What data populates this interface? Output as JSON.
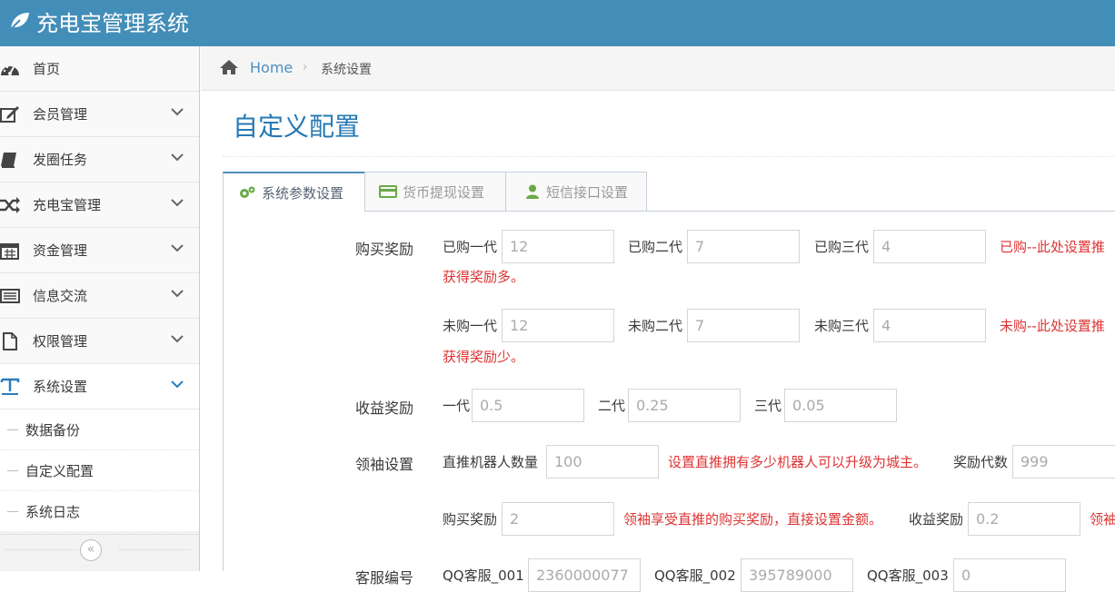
{
  "app": {
    "title": "充电宝管理系统"
  },
  "sidebar": {
    "items": [
      {
        "label": "首页",
        "icon": "dashboard-icon"
      },
      {
        "label": "会员管理",
        "icon": "edit-icon"
      },
      {
        "label": "发圈任务",
        "icon": "book-icon"
      },
      {
        "label": "充电宝管理",
        "icon": "random-icon"
      },
      {
        "label": "资金管理",
        "icon": "calendar-icon"
      },
      {
        "label": "信息交流",
        "icon": "list-icon"
      },
      {
        "label": "权限管理",
        "icon": "file-icon"
      },
      {
        "label": "系统设置",
        "icon": "text-width-icon"
      }
    ],
    "sub_items": [
      {
        "label": "数据备份"
      },
      {
        "label": "自定义配置"
      },
      {
        "label": "系统日志"
      }
    ],
    "collapse": "«"
  },
  "breadcrumb": {
    "home": "Home",
    "current": "系统设置"
  },
  "page": {
    "title": "自定义配置"
  },
  "tabs": [
    {
      "label": "系统参数设置",
      "icon": "cogs-icon",
      "active": true
    },
    {
      "label": "货币提现设置",
      "icon": "credit-card-icon",
      "active": false
    },
    {
      "label": "短信接口设置",
      "icon": "user-icon",
      "active": false
    }
  ],
  "form": {
    "purchase": {
      "label": "购买奖励",
      "bought": {
        "l1": "已购一代",
        "v1": "12",
        "l2": "已购二代",
        "v2": "7",
        "l3": "已购三代",
        "v3": "4",
        "hint": "已购--此处设置推",
        "hint2": "获得奖励多。"
      },
      "notbought": {
        "l1": "未购一代",
        "v1": "12",
        "l2": "未购二代",
        "v2": "7",
        "l3": "未购三代",
        "v3": "4",
        "hint": "未购--此处设置推",
        "hint2": "获得奖励少。"
      }
    },
    "income": {
      "label": "收益奖励",
      "l1": "一代",
      "v1": "0.5",
      "l2": "二代",
      "v2": "0.25",
      "l3": "三代",
      "v3": "0.05"
    },
    "leader": {
      "label": "领袖设置",
      "robots_label": "直推机器人数量",
      "robots": "100",
      "robots_hint": "设置直推拥有多少机器人可以升级为城主。",
      "gen_label": "奖励代数",
      "gen": "999",
      "buy_label": "购买奖励",
      "buy": "2",
      "buy_hint": "领袖享受直推的购买奖励，直接设置金额。",
      "inc_label": "收益奖励",
      "inc": "0.2",
      "inc_hint": "领袖"
    },
    "service": {
      "label": "客服编号",
      "qq1_label": "QQ客服_001",
      "qq1": "2360000077",
      "qq2_label": "QQ客服_002",
      "qq2": "395789000",
      "qq3_label": "QQ客服_003",
      "qq3": "0"
    }
  },
  "colors": {
    "topbar": "#438eb9",
    "accent": "#2679b5",
    "hint": "#dd3333"
  }
}
